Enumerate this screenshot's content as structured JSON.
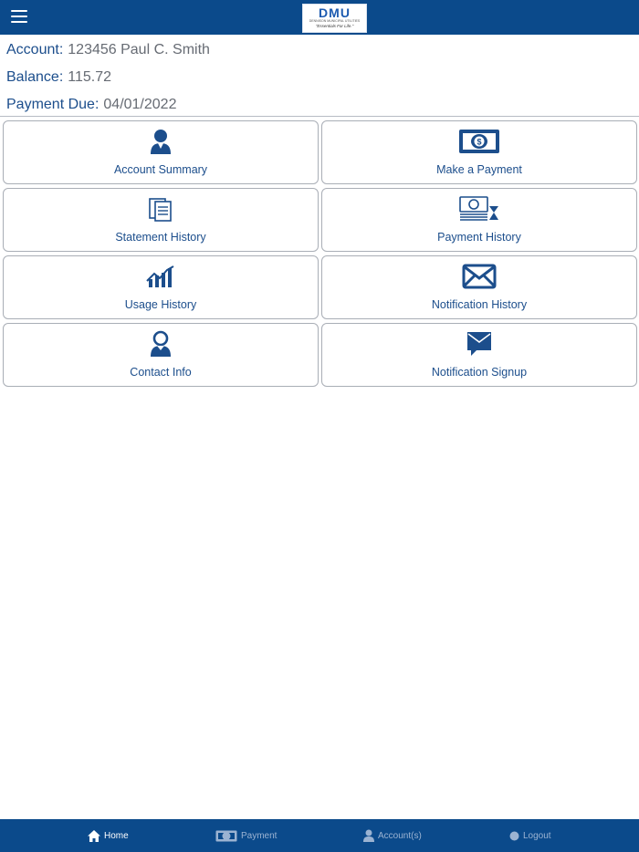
{
  "header": {
    "logo_text": "DMU",
    "logo_subtitle": "DENNISON MUNICIPAL UTILITIES",
    "logo_tagline": "\"Essentials For Life.\""
  },
  "account": {
    "account_label": "Account:",
    "account_value": "123456 Paul C. Smith",
    "balance_label": "Balance:",
    "balance_value": "115.72",
    "due_label": "Payment Due:",
    "due_value": "04/01/2022"
  },
  "tiles": [
    {
      "label": "Account Summary",
      "icon": "user-icon"
    },
    {
      "label": "Make a Payment",
      "icon": "money-icon"
    },
    {
      "label": "Statement History",
      "icon": "documents-icon"
    },
    {
      "label": "Payment History",
      "icon": "cash-hourglass-icon"
    },
    {
      "label": "Usage History",
      "icon": "chart-icon"
    },
    {
      "label": "Notification History",
      "icon": "envelope-icon"
    },
    {
      "label": "Contact Info",
      "icon": "contact-icon"
    },
    {
      "label": "Notification Signup",
      "icon": "signup-envelope-icon"
    }
  ],
  "bottom_nav": [
    {
      "label": "Home",
      "icon": "home-icon",
      "active": true
    },
    {
      "label": "Payment",
      "icon": "money-icon",
      "active": false
    },
    {
      "label": "Account(s)",
      "icon": "user-icon",
      "active": false
    },
    {
      "label": "Logout",
      "icon": "logout-icon",
      "active": false
    }
  ],
  "colors": {
    "brand_blue": "#0b4a8b",
    "label_blue": "#1c4e8c",
    "value_gray": "#666b73"
  }
}
